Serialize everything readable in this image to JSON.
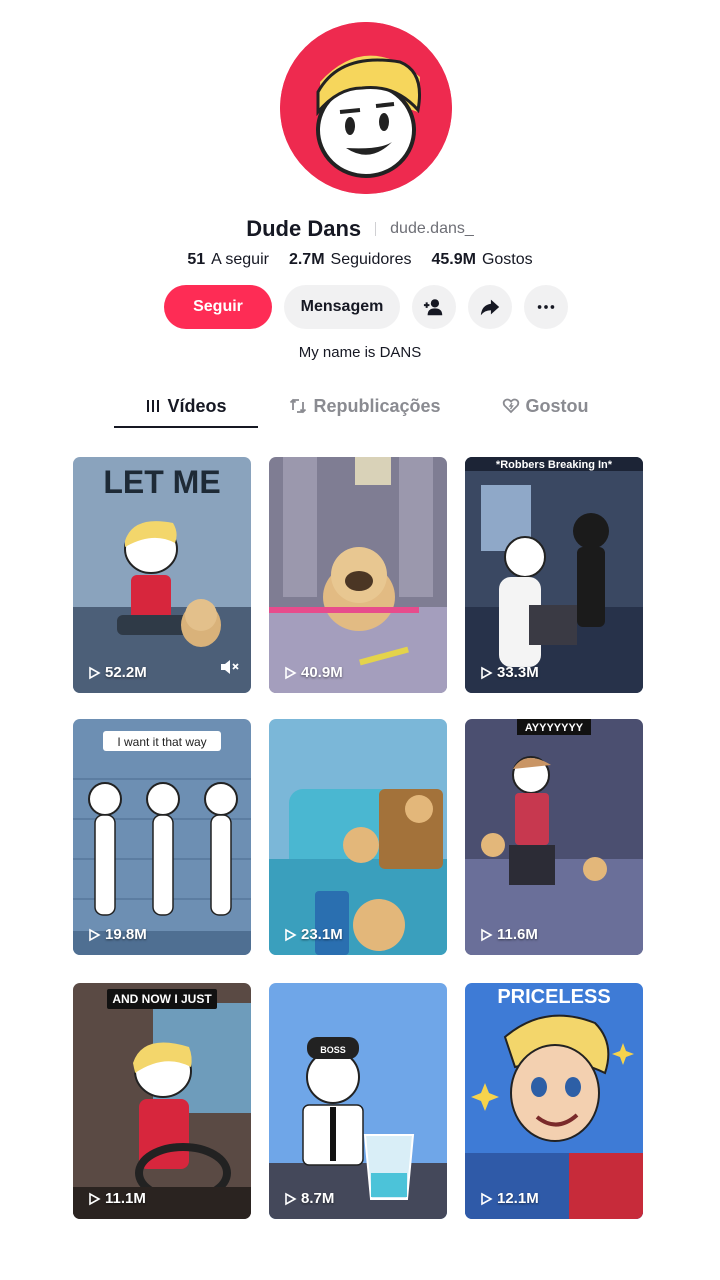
{
  "profile": {
    "name": "Dude Dans",
    "handle": "dude.dans_",
    "bio": "My name is DANS",
    "avatar_bg": "#ee2a4f"
  },
  "stats": [
    {
      "value": "51",
      "label": "A seguir"
    },
    {
      "value": "2.7M",
      "label": "Seguidores"
    },
    {
      "value": "45.9M",
      "label": "Gostos"
    }
  ],
  "actions": {
    "follow_label": "Seguir",
    "message_label": "Mensagem",
    "follow_color": "#fe2c55"
  },
  "tabs": [
    {
      "label": "Vídeos",
      "icon": "grid-lines-icon"
    },
    {
      "label": "Republicações",
      "icon": "repost-icon"
    },
    {
      "label": "Gostou",
      "icon": "heart-icon"
    }
  ],
  "videos": [
    {
      "views": "52.2M",
      "caption": "LET ME",
      "muted_icon": "mute-icon"
    },
    {
      "views": "40.9M",
      "caption": ""
    },
    {
      "views": "33.3M",
      "caption": "*Robbers Breaking In*"
    },
    {
      "views": "19.8M",
      "caption": "I want it that way"
    },
    {
      "views": "23.1M",
      "caption": ""
    },
    {
      "views": "11.6M",
      "caption": "AYYYYYYY"
    },
    {
      "views": "11.1M",
      "caption": "AND NOW I JUST"
    },
    {
      "views": "8.7M",
      "caption": "BOSS"
    },
    {
      "views": "12.1M",
      "caption": "PRICELESS"
    }
  ]
}
